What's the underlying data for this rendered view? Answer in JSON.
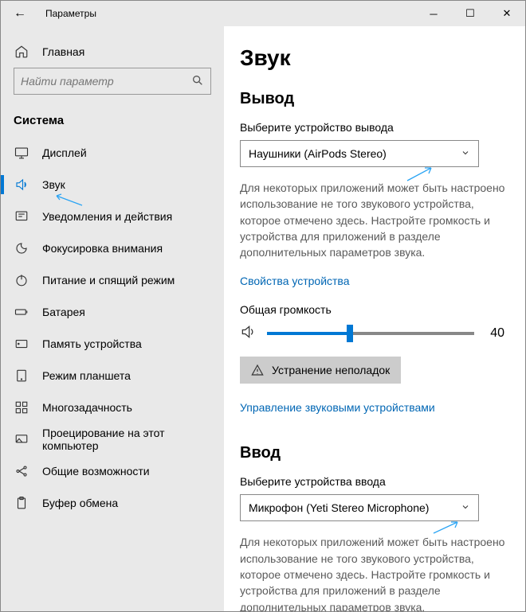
{
  "titlebar": {
    "title": "Параметры"
  },
  "home_label": "Главная",
  "search": {
    "placeholder": "Найти параметр"
  },
  "category": "Система",
  "nav": [
    {
      "label": "Дисплей"
    },
    {
      "label": "Звук"
    },
    {
      "label": "Уведомления и действия"
    },
    {
      "label": "Фокусировка внимания"
    },
    {
      "label": "Питание и спящий режим"
    },
    {
      "label": "Батарея"
    },
    {
      "label": "Память устройства"
    },
    {
      "label": "Режим планшета"
    },
    {
      "label": "Многозадачность"
    },
    {
      "label": "Проецирование на этот компьютер"
    },
    {
      "label": "Общие возможности"
    },
    {
      "label": "Буфер обмена"
    }
  ],
  "page": {
    "title": "Звук",
    "output": {
      "heading": "Вывод",
      "select_label": "Выберите устройство вывода",
      "selected": "Наушники (AirPods Stereo)",
      "desc": "Для некоторых приложений может быть настроено использование не того звукового устройства, которое отмечено здесь. Настройте громкость и устройства для приложений в разделе дополнительных параметров звука.",
      "properties_link": "Свойства устройства",
      "volume_label": "Общая громкость",
      "volume_value": "40",
      "troubleshoot": "Устранение неполадок",
      "manage_link": "Управление звуковыми устройствами"
    },
    "input": {
      "heading": "Ввод",
      "select_label": "Выберите устройства ввода",
      "selected": "Микрофон (Yeti Stereo Microphone)",
      "desc": "Для некоторых приложений может быть настроено использование не того звукового устройства, которое отмечено здесь. Настройте громкость и устройства для приложений в разделе дополнительных параметров звука."
    }
  }
}
